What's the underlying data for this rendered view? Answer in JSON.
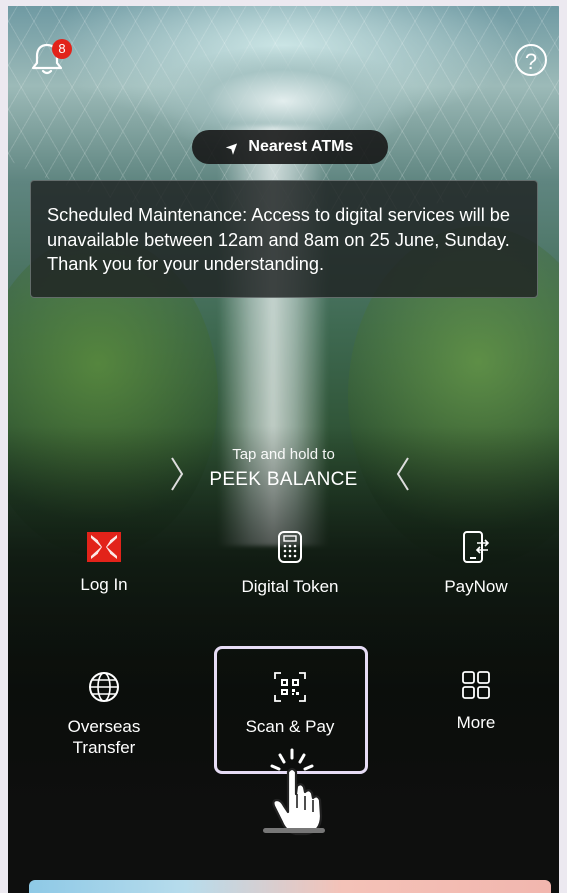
{
  "header": {
    "notification_count": "8",
    "help_glyph": "?"
  },
  "atm_button": {
    "icon": "location-arrow-icon",
    "label": "Nearest ATMs"
  },
  "notice": {
    "text": "Scheduled Maintenance: Access to digital services will be unavailable between 12am and 8am on 25 June, Sunday. Thank you for your understanding."
  },
  "peek": {
    "hint": "Tap and hold to",
    "label": "PEEK BALANCE"
  },
  "quick_actions": [
    {
      "label": "Log In",
      "icon": "bank-logo-icon"
    },
    {
      "label": "Digital Token",
      "icon": "token-device-icon"
    },
    {
      "label": "PayNow",
      "icon": "phone-transfer-icon"
    },
    {
      "label": "Overseas\nTransfer",
      "icon": "globe-icon"
    },
    {
      "label": "Scan & Pay",
      "icon": "qr-scan-icon"
    },
    {
      "label": "More",
      "icon": "grid-icon"
    }
  ],
  "colors": {
    "badge": "#e2231a",
    "logo_red": "#e2231a",
    "highlight_frame": "#e6dcf5"
  }
}
